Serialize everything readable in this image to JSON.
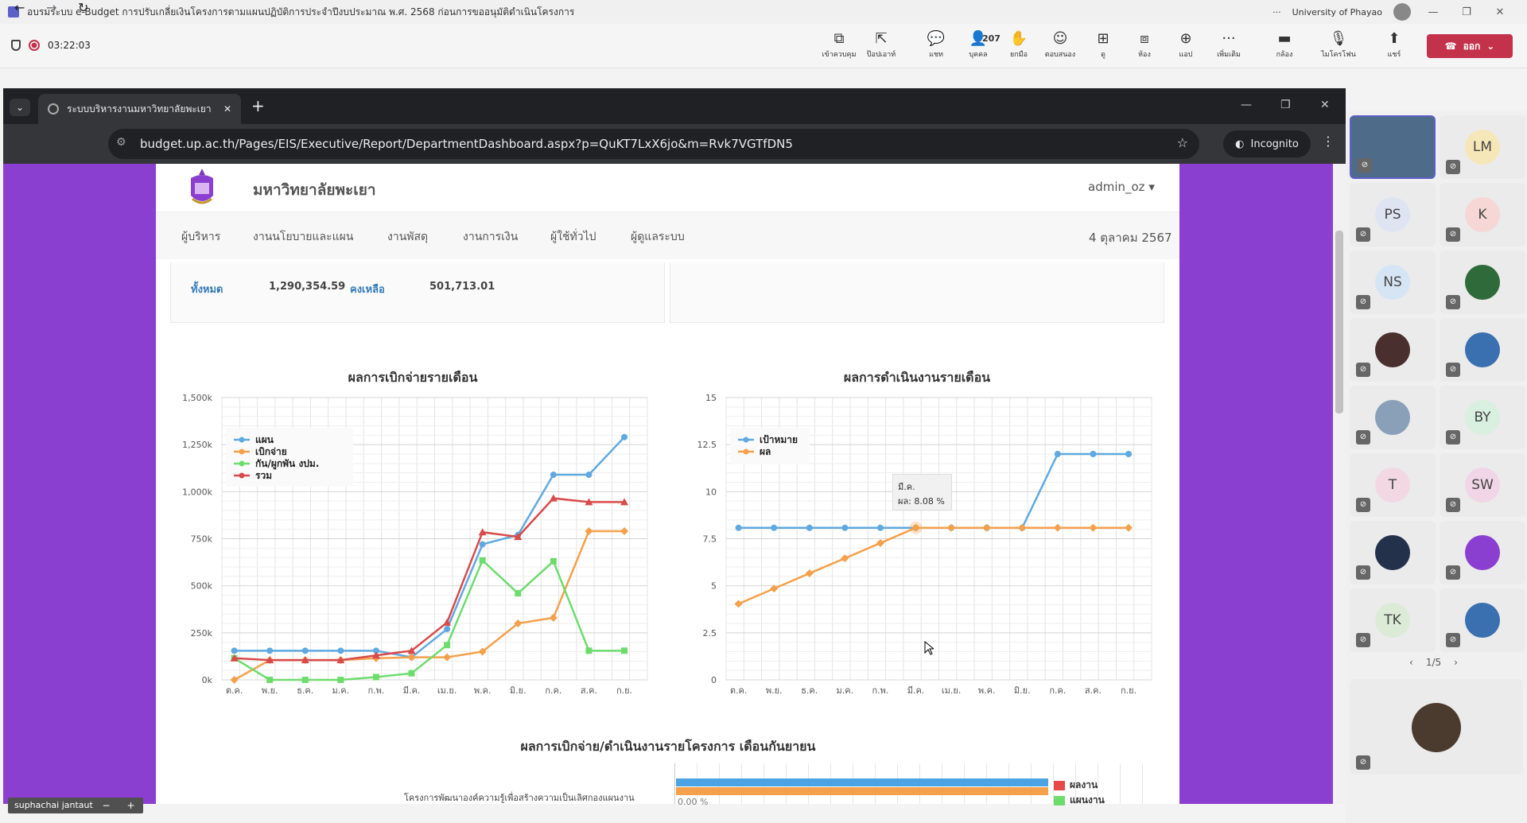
{
  "teams": {
    "window_title": "อบรมระบบ e-Budget การปรับเกลี่ยเงินโครงการตามแผนปฏิบัติการประจำปีงบประมาณ พ.ศ. 2568 ก่อนการขออนุมัติดำเนินโครงการ",
    "more": "···",
    "org": "University of Phayao",
    "timer": "03:22:03",
    "toolbar": [
      {
        "icon": "⧉",
        "label": "เข้าควบคุม",
        "name": "take-control"
      },
      {
        "icon": "⇱",
        "label": "ป๊อปเอาท์",
        "name": "pop-out"
      },
      {
        "icon": "💬",
        "label": "แชท",
        "name": "chat"
      },
      {
        "icon": "👤",
        "label": "บุคคล",
        "name": "people",
        "count": "207"
      },
      {
        "icon": "✋",
        "label": "ยกมือ",
        "name": "raise-hand"
      },
      {
        "icon": "☺",
        "label": "ตอบสนอง",
        "name": "react"
      },
      {
        "icon": "⊞",
        "label": "ดู",
        "name": "view"
      },
      {
        "icon": "⧈",
        "label": "ห้อง",
        "name": "rooms"
      },
      {
        "icon": "⊕",
        "label": "แอป",
        "name": "apps"
      },
      {
        "icon": "···",
        "label": "เพิ่มเติม",
        "name": "more"
      },
      {
        "icon": "▬",
        "label": "กล้อง",
        "name": "camera"
      },
      {
        "icon": "🎙",
        "label": "ไมโครโฟน",
        "name": "mic"
      },
      {
        "icon": "⬆",
        "label": "แชร์",
        "name": "share"
      }
    ],
    "leave_label": "ออก"
  },
  "browser": {
    "tab_title": "ระบบบริหารงานมหาวิทยาลัยพะเยา",
    "url": "budget.up.ac.th/Pages/EIS/Executive/Report/DepartmentDashboard.aspx?p=QuKT7LxX6jo&m=Rvk7VGTfDN5",
    "incognito": "Incognito"
  },
  "site": {
    "university": "มหาวิทยาลัยพะเยา",
    "user": "admin_oz ▾",
    "nav": [
      "ผู้บริหาร",
      "งานนโยบายและแผน",
      "งานพัสดุ",
      "งานการเงิน",
      "ผู้ใช้ทั่วไป",
      "ผู้ดูแลระบบ"
    ],
    "date": "4 ตุลาคม 2567",
    "summary": {
      "total_label": "ทั้งหมด",
      "total_value": "1,290,354.59",
      "remain_label": "คงเหลือ",
      "remain_value": "501,713.01"
    },
    "section_title": "ผลการเบิกจ่าย/ดำเนินงานรายโครงการ เดือนกันยายน",
    "project_label": "โครงการพัฒนาองค์ความรู้เพื่อสร้างความเป็นเลิศกองแผนงาน",
    "project_pct": "0.00 %",
    "bar_legend": [
      {
        "name": "ผลงาน",
        "color": "#e64848"
      },
      {
        "name": "แผนงาน",
        "color": "#6ddc6d"
      }
    ],
    "tooltip": {
      "month": "มี.ค.",
      "text": "ผล: 8.08 %"
    }
  },
  "chart_data": [
    {
      "type": "line",
      "title": "ผลการเบิกจ่ายรายเดือน",
      "categories": [
        "ต.ค.",
        "พ.ย.",
        "ธ.ค.",
        "ม.ค.",
        "ก.พ.",
        "มี.ค.",
        "เม.ย.",
        "พ.ค.",
        "มิ.ย.",
        "ก.ค.",
        "ส.ค.",
        "ก.ย."
      ],
      "ylim": [
        0,
        1500000
      ],
      "yticks": [
        "0k",
        "250k",
        "500k",
        "750k",
        "1,000k",
        "1,250k",
        "1,500k"
      ],
      "legend": "top-left",
      "series": [
        {
          "name": "แผน",
          "color": "#5fa9e0",
          "marker": "circle",
          "values": [
            155000,
            155000,
            155000,
            155000,
            155000,
            120000,
            270000,
            720000,
            770000,
            1090000,
            1090000,
            1290000
          ]
        },
        {
          "name": "เบิกจ่าย",
          "color": "#f5a04a",
          "marker": "diamond",
          "values": [
            0,
            105000,
            105000,
            105000,
            115000,
            120000,
            120000,
            150000,
            300000,
            330000,
            790000,
            790000
          ]
        },
        {
          "name": "กัน/ผูกพัน งปม.",
          "color": "#6ddc6d",
          "marker": "square",
          "values": [
            115000,
            0,
            0,
            0,
            15000,
            35000,
            185000,
            635000,
            460000,
            630000,
            155000,
            155000
          ]
        },
        {
          "name": "รวม",
          "color": "#d94a4a",
          "marker": "triangle",
          "values": [
            115000,
            105000,
            105000,
            105000,
            130000,
            155000,
            305000,
            785000,
            760000,
            965000,
            945000,
            945000
          ]
        }
      ]
    },
    {
      "type": "line",
      "title": "ผลการดำเนินงานรายเดือน",
      "categories": [
        "ต.ค.",
        "พ.ย.",
        "ธ.ค.",
        "ม.ค.",
        "ก.พ.",
        "มี.ค.",
        "เม.ย.",
        "พ.ค.",
        "มิ.ย.",
        "ก.ค.",
        "ส.ค.",
        "ก.ย."
      ],
      "ylim": [
        0,
        15
      ],
      "yticks": [
        "0",
        "2.5",
        "5",
        "7.5",
        "10",
        "12.5",
        "15"
      ],
      "legend": "top-left",
      "series": [
        {
          "name": "เป้าหมาย",
          "color": "#5fa9e0",
          "marker": "circle",
          "values": [
            8.08,
            8.08,
            8.08,
            8.08,
            8.08,
            8.08,
            8.08,
            8.08,
            8.08,
            12,
            12,
            12
          ]
        },
        {
          "name": "ผล",
          "color": "#f5a04a",
          "marker": "diamond",
          "values": [
            4.04,
            4.85,
            5.66,
            6.46,
            7.27,
            8.08,
            8.08,
            8.08,
            8.08,
            8.08,
            8.08,
            8.08
          ]
        }
      ]
    }
  ],
  "participants": {
    "tiles": [
      {
        "initials": "",
        "bg": "#4f6b8a",
        "kind": "video"
      },
      {
        "initials": "LM",
        "bg": "#f6e7b9"
      },
      {
        "initials": "PS",
        "bg": "#dfe4f3"
      },
      {
        "initials": "K",
        "bg": "#f6d7d5"
      },
      {
        "initials": "NS",
        "bg": "#d6e5f5"
      },
      {
        "initials": "",
        "bg": "#2f6b3a"
      },
      {
        "initials": "",
        "bg": "#4a2f2f"
      },
      {
        "initials": "",
        "bg": "#3a6fb0"
      },
      {
        "initials": "",
        "bg": "#8aa0b8"
      },
      {
        "initials": "BY",
        "bg": "#d9efdf"
      },
      {
        "initials": "T",
        "bg": "#f2d8e3"
      },
      {
        "initials": "SW",
        "bg": "#f0d6e6"
      },
      {
        "initials": "",
        "bg": "#23314a"
      },
      {
        "initials": "",
        "bg": "#8b3fd1"
      },
      {
        "initials": "TK",
        "bg": "#dcebd8"
      },
      {
        "initials": "",
        "bg": "#3a6fb0"
      }
    ],
    "pager": "1/5",
    "self_name": "suphachai jantaut"
  }
}
